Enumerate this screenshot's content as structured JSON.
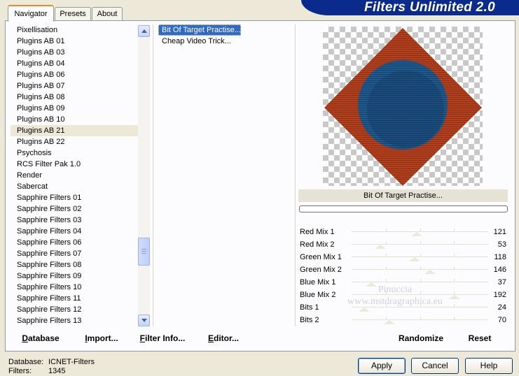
{
  "app_title": "Filters Unlimited 2.0",
  "tabs": [
    {
      "label": "Navigator",
      "active": true
    },
    {
      "label": "Presets",
      "active": false
    },
    {
      "label": "About",
      "active": false
    }
  ],
  "categories": [
    "Pixellisation",
    "Plugins AB 01",
    "Plugins AB 03",
    "Plugins AB 04",
    "Plugins AB 06",
    "Plugins AB 07",
    "Plugins AB 08",
    "Plugins AB 09",
    "Plugins AB 10",
    "Plugins AB 21",
    "Plugins AB 22",
    "Psychosis",
    "RCS Filter Pak 1.0",
    "Render",
    "Sabercat",
    "Sapphire Filters 01",
    "Sapphire Filters 02",
    "Sapphire Filters 03",
    "Sapphire Filters 04",
    "Sapphire Filters 06",
    "Sapphire Filters 07",
    "Sapphire Filters 08",
    "Sapphire Filters 09",
    "Sapphire Filters 10",
    "Sapphire Filters 11",
    "Sapphire Filters 12",
    "Sapphire Filters 13"
  ],
  "selected_category": "Plugins AB 21",
  "filters": [
    "Bit Of Target Practise...",
    "Cheap Video Trick..."
  ],
  "selected_filter": "Bit Of Target Practise...",
  "preview": {
    "label": "Bit Of Target Practise...",
    "progress": 0
  },
  "sliders": [
    {
      "label": "Red Mix 1",
      "value": 121
    },
    {
      "label": "Red Mix 2",
      "value": 53
    },
    {
      "label": "Green Mix 1",
      "value": 118
    },
    {
      "label": "Green Mix 2",
      "value": 146
    },
    {
      "label": "Blue Mix 1",
      "value": 37
    },
    {
      "label": "Blue Mix 2",
      "value": 192
    },
    {
      "label": "Bits 1",
      "value": 24
    },
    {
      "label": "Bits 2",
      "value": 70
    }
  ],
  "slider_max": 255,
  "left_buttons": [
    {
      "label": "Database",
      "underline": "D"
    },
    {
      "label": "Import...",
      "underline": "I"
    },
    {
      "label": "Filter Info...",
      "underline": "F"
    },
    {
      "label": "Editor...",
      "underline": "E"
    }
  ],
  "right_buttons": [
    {
      "label": "Randomize"
    },
    {
      "label": "Reset"
    }
  ],
  "dialog_buttons": [
    {
      "label": "Apply",
      "default": true
    },
    {
      "label": "Cancel",
      "default": false
    },
    {
      "label": "Help",
      "default": false
    }
  ],
  "status": {
    "database_label": "Database:",
    "database_value": "ICNET-Filters",
    "filters_label": "Filters:",
    "filters_value": "1345"
  },
  "watermark": {
    "line1": "Pinuccia",
    "line2": "www.mstdragraphica.eu"
  },
  "colors": {
    "banner": "#0a2a8c",
    "selection": "#316ac5",
    "preview_outer": "#b5401e",
    "preview_inner": "#1f5a8e"
  },
  "icons": {
    "scroll_up": "chevron-up-icon",
    "scroll_down": "chevron-down-icon"
  }
}
